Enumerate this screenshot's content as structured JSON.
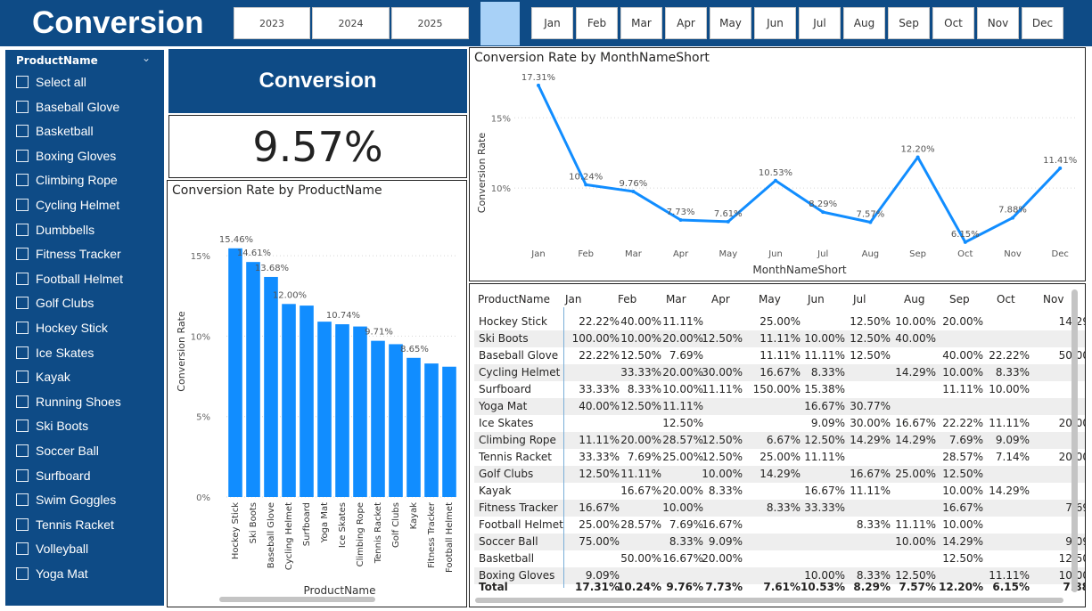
{
  "header": {
    "title": "Conversion",
    "years": [
      "2023",
      "2024",
      "2025"
    ],
    "months": [
      "Jan",
      "Feb",
      "Mar",
      "Apr",
      "May",
      "Jun",
      "Jul",
      "Aug",
      "Sep",
      "Oct",
      "Nov",
      "Dec"
    ]
  },
  "slicer": {
    "title": "ProductName",
    "items": [
      "Select all",
      "Baseball Glove",
      "Basketball",
      "Boxing Gloves",
      "Climbing Rope",
      "Cycling Helmet",
      "Dumbbells",
      "Fitness Tracker",
      "Football Helmet",
      "Golf Clubs",
      "Hockey Stick",
      "Ice Skates",
      "Kayak",
      "Running Shoes",
      "Ski Boots",
      "Soccer Ball",
      "Surfboard",
      "Swim Goggles",
      "Tennis Racket",
      "Volleyball",
      "Yoga Mat"
    ]
  },
  "kpi": {
    "title": "Conversion",
    "value": "9.57%"
  },
  "colors": {
    "brand": "#0e4b86",
    "accent": "#118dff",
    "selected": "#a8d1f7"
  },
  "chart_data": [
    {
      "type": "bar",
      "title": "Conversion Rate by ProductName",
      "xlabel": "ProductName",
      "ylabel": "Conversion Rate",
      "ylim": [
        0,
        0.17
      ],
      "yticks": [
        "0%",
        "5%",
        "10%",
        "15%"
      ],
      "categories": [
        "Hockey Stick",
        "Ski Boots",
        "Baseball Glove",
        "Cycling Helmet",
        "Surfboard",
        "Yoga Mat",
        "Ice Skates",
        "Climbing Rope",
        "Tennis Racket",
        "Golf Clubs",
        "Kayak",
        "Fitness Tracker",
        "Football Helmet"
      ],
      "values": [
        0.1546,
        0.1461,
        0.1368,
        0.12,
        0.119,
        0.109,
        0.1074,
        0.106,
        0.0971,
        0.095,
        0.0865,
        0.083,
        0.081
      ],
      "data_labels": [
        "15.46%",
        "14.61%",
        "13.68%",
        "12.00%",
        "",
        "",
        "10.74%",
        "",
        "9.71%",
        "",
        "8.65%",
        "",
        ""
      ],
      "grid": true
    },
    {
      "type": "line",
      "title": "Conversion Rate by MonthNameShort",
      "xlabel": "MonthNameShort",
      "ylabel": "Conversion Rate",
      "ylim": [
        0.05,
        0.18
      ],
      "yticks": [
        "10%",
        "15%"
      ],
      "categories": [
        "Jan",
        "Feb",
        "Mar",
        "Apr",
        "May",
        "Jun",
        "Jul",
        "Aug",
        "Sep",
        "Oct",
        "Nov",
        "Dec"
      ],
      "values": [
        0.1731,
        0.1024,
        0.0976,
        0.0773,
        0.0761,
        0.1053,
        0.0829,
        0.0757,
        0.122,
        0.0615,
        0.0788,
        0.1141
      ],
      "data_labels": [
        "17.31%",
        "10.24%",
        "9.76%",
        "7.73%",
        "7.61%",
        "10.53%",
        "8.29%",
        "7.57%",
        "12.20%",
        "6.15%",
        "7.88%",
        "11.41%"
      ],
      "grid": true
    },
    {
      "type": "table",
      "columns": [
        "ProductName",
        "Jan",
        "Feb",
        "Mar",
        "Apr",
        "May",
        "Jun",
        "Jul",
        "Aug",
        "Sep",
        "Oct",
        "Nov"
      ],
      "rows": [
        [
          "Hockey Stick",
          "22.22%",
          "40.00%",
          "11.11%",
          "",
          "25.00%",
          "",
          "12.50%",
          "10.00%",
          "20.00%",
          "",
          "14.29"
        ],
        [
          "Ski Boots",
          "100.00%",
          "10.00%",
          "20.00%",
          "12.50%",
          "11.11%",
          "10.00%",
          "12.50%",
          "40.00%",
          "",
          "",
          ""
        ],
        [
          "Baseball Glove",
          "22.22%",
          "12.50%",
          "7.69%",
          "",
          "11.11%",
          "11.11%",
          "12.50%",
          "",
          "40.00%",
          "22.22%",
          "50.00"
        ],
        [
          "Cycling Helmet",
          "",
          "33.33%",
          "20.00%",
          "30.00%",
          "16.67%",
          "8.33%",
          "",
          "14.29%",
          "10.00%",
          "8.33%",
          ""
        ],
        [
          "Surfboard",
          "33.33%",
          "8.33%",
          "10.00%",
          "11.11%",
          "150.00%",
          "15.38%",
          "",
          "",
          "11.11%",
          "10.00%",
          ""
        ],
        [
          "Yoga Mat",
          "40.00%",
          "12.50%",
          "11.11%",
          "",
          "",
          "16.67%",
          "30.77%",
          "",
          "",
          "",
          ""
        ],
        [
          "Ice Skates",
          "",
          "",
          "12.50%",
          "",
          "",
          "9.09%",
          "30.00%",
          "16.67%",
          "22.22%",
          "11.11%",
          "20.00"
        ],
        [
          "Climbing Rope",
          "11.11%",
          "20.00%",
          "28.57%",
          "12.50%",
          "6.67%",
          "12.50%",
          "14.29%",
          "14.29%",
          "7.69%",
          "9.09%",
          ""
        ],
        [
          "Tennis Racket",
          "33.33%",
          "7.69%",
          "25.00%",
          "12.50%",
          "25.00%",
          "11.11%",
          "",
          "",
          "28.57%",
          "7.14%",
          "20.00"
        ],
        [
          "Golf Clubs",
          "12.50%",
          "11.11%",
          "",
          "10.00%",
          "14.29%",
          "",
          "16.67%",
          "25.00%",
          "12.50%",
          "",
          ""
        ],
        [
          "Kayak",
          "",
          "16.67%",
          "20.00%",
          "8.33%",
          "",
          "16.67%",
          "11.11%",
          "",
          "10.00%",
          "14.29%",
          ""
        ],
        [
          "Fitness Tracker",
          "16.67%",
          "",
          "10.00%",
          "",
          "8.33%",
          "33.33%",
          "",
          "",
          "16.67%",
          "",
          "7.69"
        ],
        [
          "Football Helmet",
          "25.00%",
          "28.57%",
          "7.69%",
          "16.67%",
          "",
          "",
          "8.33%",
          "11.11%",
          "10.00%",
          "",
          ""
        ],
        [
          "Soccer Ball",
          "75.00%",
          "",
          "8.33%",
          "9.09%",
          "",
          "",
          "",
          "10.00%",
          "14.29%",
          "",
          "9.09"
        ],
        [
          "Basketball",
          "",
          "50.00%",
          "16.67%",
          "20.00%",
          "",
          "",
          "",
          "",
          "12.50%",
          "",
          "12.50"
        ],
        [
          "Boxing Gloves",
          "9.09%",
          "",
          "",
          "",
          "",
          "10.00%",
          "8.33%",
          "12.50%",
          "",
          "11.11%",
          "10.00"
        ]
      ],
      "total": [
        "Total",
        "17.31%",
        "10.24%",
        "9.76%",
        "7.73%",
        "7.61%",
        "10.53%",
        "8.29%",
        "7.57%",
        "12.20%",
        "6.15%",
        "7.88"
      ]
    }
  ]
}
